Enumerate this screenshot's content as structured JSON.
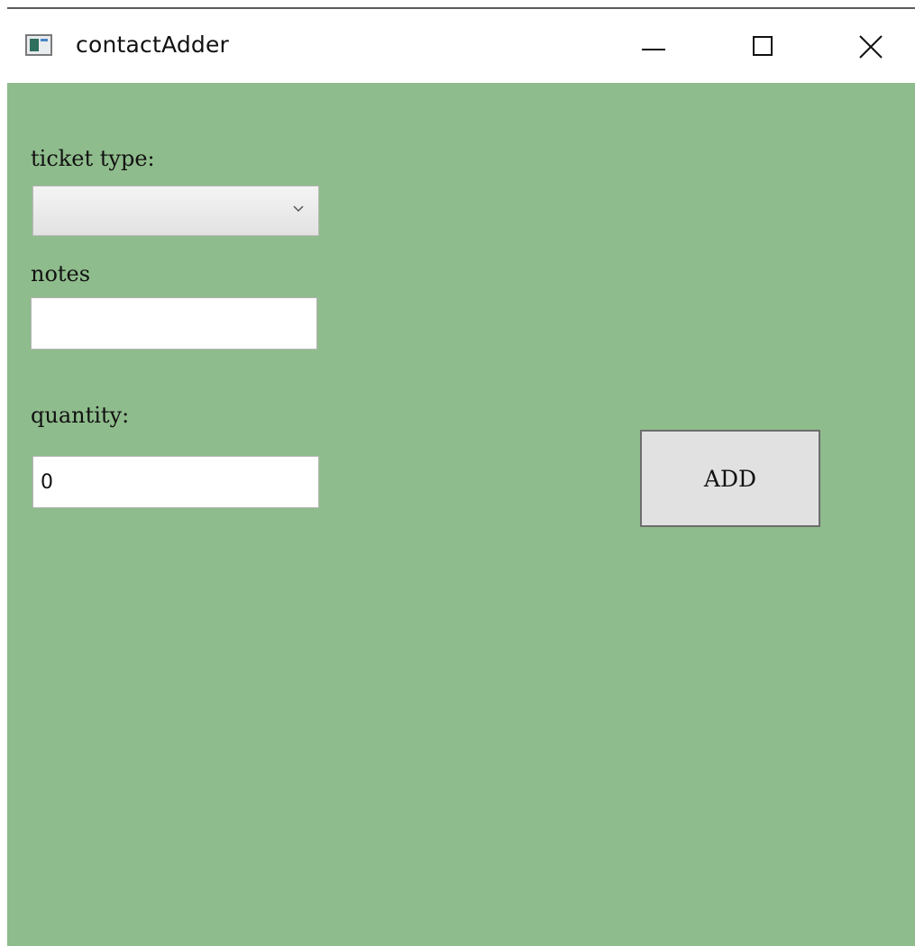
{
  "window": {
    "title": "contactAdder",
    "icon": "app-window-icon",
    "controls": [
      "minimize-icon",
      "maximize-icon",
      "close-icon"
    ]
  },
  "form": {
    "ticket_type_label": "ticket type:",
    "ticket_type_value": "",
    "notes_label": "notes",
    "notes_value": "",
    "quantity_label": "quantity:",
    "quantity_value": "0",
    "add_label": "ADD"
  },
  "colors": {
    "client_background": "#8fbc8c",
    "button_background": "#e1e1e1"
  }
}
